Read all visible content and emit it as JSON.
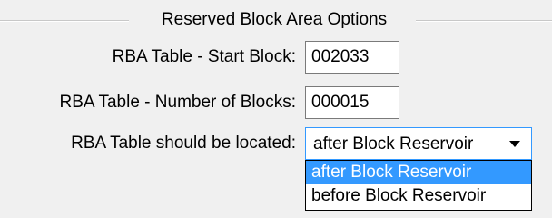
{
  "group": {
    "title": "Reserved Block Area Options"
  },
  "fields": {
    "start_block": {
      "label": "RBA Table - Start Block:",
      "value": "002033"
    },
    "number_of_blocks": {
      "label": "RBA Table - Number of Blocks:",
      "value": "000015"
    },
    "location": {
      "label": "RBA Table should be located:",
      "selected": "after Block Reservoir",
      "options": [
        "after Block Reservoir",
        "before Block Reservoir"
      ]
    }
  },
  "colors": {
    "selection": "#3399ff",
    "background": "#f0f0f0"
  },
  "icons": {
    "dropdown_arrow": "chevron-down-icon"
  }
}
